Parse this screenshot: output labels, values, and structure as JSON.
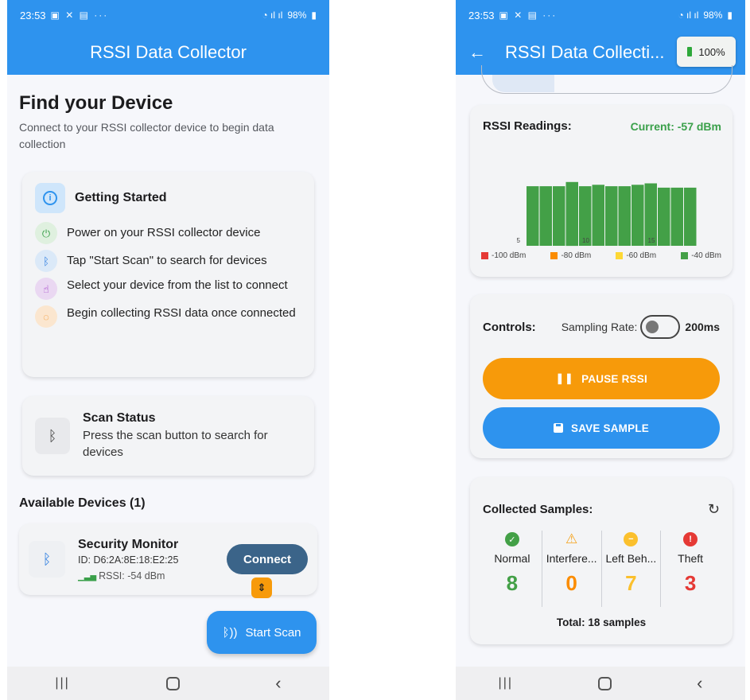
{
  "status_bar": {
    "time": "23:53",
    "battery": "98%"
  },
  "left_screen": {
    "app_title": "RSSI Data Collector",
    "heading": "Find your Device",
    "subtitle": "Connect to your RSSI collector device to begin data collection",
    "getting_started": {
      "title": "Getting Started",
      "steps": [
        {
          "icon": "power-icon",
          "text": "Power on your RSSI collector device"
        },
        {
          "icon": "bluetooth-search-icon",
          "text": "Tap \"Start Scan\" to search for devices"
        },
        {
          "icon": "touch-icon",
          "text": "Select your device from the list to connect"
        },
        {
          "icon": "loading-icon",
          "text": "Begin collecting RSSI data once connected"
        }
      ]
    },
    "scan_status": {
      "title": "Scan Status",
      "text": "Press the scan button to search for devices"
    },
    "devices": {
      "label": "Available Devices (1)",
      "items": [
        {
          "name": "Security Monitor",
          "id": "ID: D6:2A:8E:18:E2:25",
          "rssi": "RSSI: -54 dBm",
          "action": "Connect"
        }
      ]
    },
    "fab": {
      "label": "Start Scan"
    }
  },
  "right_screen": {
    "app_title": "RSSI Data Collecti...",
    "battery_pill": "100%",
    "rssi_card": {
      "title": "RSSI Readings:",
      "current": "Current: -57 dBm",
      "legend": [
        {
          "label": "-100 dBm",
          "color": "#e53935"
        },
        {
          "label": "-80 dBm",
          "color": "#fb8c00"
        },
        {
          "label": "-60 dBm",
          "color": "#fdd835"
        },
        {
          "label": "-40 dBm",
          "color": "#43a047"
        }
      ]
    },
    "chart_data": {
      "type": "bar",
      "x_ticks": [
        "0",
        "5",
        "10",
        "15"
      ],
      "x": [
        6,
        7,
        8,
        9,
        10,
        11,
        12,
        13,
        14,
        15,
        16,
        17,
        18
      ],
      "values": [
        -58,
        -58,
        -58,
        -55,
        -58,
        -57,
        -58,
        -58,
        -57,
        -56,
        -59,
        -59,
        -59
      ],
      "ylim": [
        -100,
        -40
      ],
      "bar_color": "#43a047"
    },
    "controls": {
      "label": "Controls:",
      "sampling_label": "Sampling Rate:",
      "sampling_value": "200ms",
      "pause_label": "PAUSE RSSI",
      "save_label": "SAVE SAMPLE"
    },
    "samples": {
      "title": "Collected Samples:",
      "categories": [
        {
          "name": "Normal",
          "count": "8",
          "color": "#43a047",
          "icon": "check-circle-icon"
        },
        {
          "name": "Interfere...",
          "count": "0",
          "color": "#fb8c00",
          "icon": "warning-triangle-icon"
        },
        {
          "name": "Left Beh...",
          "count": "7",
          "color": "#fbc02d",
          "icon": "minus-circle-icon"
        },
        {
          "name": "Theft",
          "count": "3",
          "color": "#e53935",
          "icon": "alert-circle-icon"
        }
      ],
      "total": "Total: 18 samples"
    }
  }
}
